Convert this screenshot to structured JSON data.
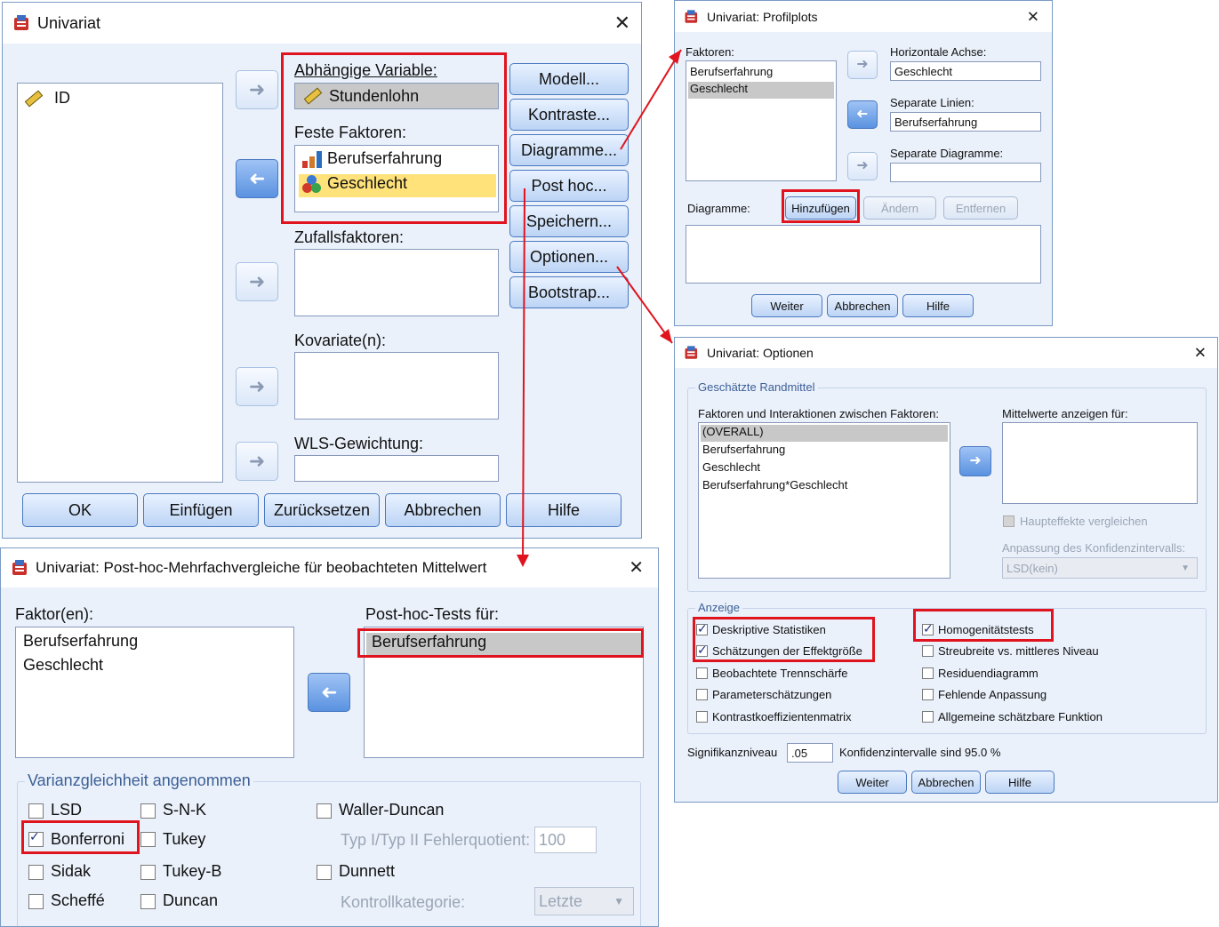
{
  "main": {
    "title": "Univariat",
    "variable_list": [
      {
        "label": "ID",
        "icon": "ruler-icon"
      }
    ],
    "dependent_label": "Abhängige Variable:",
    "dependent_value": "Stundenlohn",
    "fixed_factors_label": "Feste Faktoren:",
    "fixed_factors": [
      "Berufserfahrung",
      "Geschlecht"
    ],
    "random_factors_label": "Zufallsfaktoren:",
    "covariates_label": "Kovariate(n):",
    "wls_label": "WLS-Gewichtung:",
    "side_buttons": [
      "Modell...",
      "Kontraste...",
      "Diagramme...",
      "Post hoc...",
      "Speichern...",
      "Optionen...",
      "Bootstrap..."
    ],
    "bottom_buttons": [
      "OK",
      "Einfügen",
      "Zurücksetzen",
      "Abbrechen",
      "Hilfe"
    ]
  },
  "profile": {
    "title": "Univariat: Profilplots",
    "factors_label": "Faktoren:",
    "factors": [
      "Berufserfahrung",
      "Geschlecht"
    ],
    "horizontal_label": "Horizontale Achse:",
    "horizontal_value": "Geschlecht",
    "lines_label": "Separate Linien:",
    "lines_value": "Berufserfahrung",
    "plots_label": "Separate Diagramme:",
    "diagrams_label": "Diagramme:",
    "add": "Hinzufügen",
    "change": "Ändern",
    "remove": "Entfernen",
    "continue": "Weiter",
    "cancel": "Abbrechen",
    "help": "Hilfe"
  },
  "options": {
    "title": "Univariat: Optionen",
    "group_marginal": "Geschätzte Randmittel",
    "factors_label": "Faktoren und Interaktionen zwischen Faktoren:",
    "factors": [
      "(OVERALL)",
      "Berufserfahrung",
      "Geschlecht",
      "Berufserfahrung*Geschlecht"
    ],
    "means_label": "Mittelwerte anzeigen für:",
    "compare_main": "Haupteffekte vergleichen",
    "ci_adjust_label": "Anpassung des Konfidenzintervalls:",
    "ci_adjust_value": "LSD(kein)",
    "group_display": "Anzeige",
    "display_left": [
      {
        "label": "Deskriptive Statistiken",
        "checked": true
      },
      {
        "label": "Schätzungen der Effektgröße",
        "checked": true
      },
      {
        "label": "Beobachtete Trennschärfe",
        "checked": false
      },
      {
        "label": "Parameterschätzungen",
        "checked": false
      },
      {
        "label": "Kontrastkoeffizientenmatrix",
        "checked": false
      }
    ],
    "display_right": [
      {
        "label": "Homogenitätstests",
        "checked": true
      },
      {
        "label": "Streubreite vs. mittleres Niveau",
        "checked": false
      },
      {
        "label": "Residuendiagramm",
        "checked": false
      },
      {
        "label": "Fehlende Anpassung",
        "checked": false
      },
      {
        "label": "Allgemeine schätzbare Funktion",
        "checked": false
      }
    ],
    "sig_label": "Signifikanzniveau",
    "sig_value": ".05",
    "ci_text": "Konfidenzintervalle sind 95.0 %",
    "continue": "Weiter",
    "cancel": "Abbrechen",
    "help": "Hilfe"
  },
  "posthoc": {
    "title": "Univariat: Post-hoc-Mehrfachvergleiche für beobachteten Mittelwert",
    "factors_label": "Faktor(en):",
    "factors": [
      "Berufserfahrung",
      "Geschlecht"
    ],
    "tests_for_label": "Post-hoc-Tests für:",
    "tests_for": [
      "Berufserfahrung"
    ],
    "group_label": "Varianzgleichheit angenommen",
    "col1": [
      {
        "label": "LSD",
        "checked": false
      },
      {
        "label": "Bonferroni",
        "checked": true
      },
      {
        "label": "Sidak",
        "checked": false
      },
      {
        "label": "Scheffé",
        "checked": false
      }
    ],
    "col2": [
      {
        "label": "S-N-K",
        "checked": false
      },
      {
        "label": "Tukey",
        "checked": false
      },
      {
        "label": "Tukey-B",
        "checked": false
      },
      {
        "label": "Duncan",
        "checked": false
      }
    ],
    "waller": "Waller-Duncan",
    "error_ratio_label": "Typ I/Typ II Fehlerquotient:",
    "error_ratio_value": "100",
    "dunnett": "Dunnett",
    "control_label": "Kontrollkategorie:",
    "control_value": "Letzte"
  },
  "colors": {
    "highlight_red": "#e0141e",
    "selection_yellow": "#ffe27a",
    "dialog_bg": "#eaf1fb"
  }
}
